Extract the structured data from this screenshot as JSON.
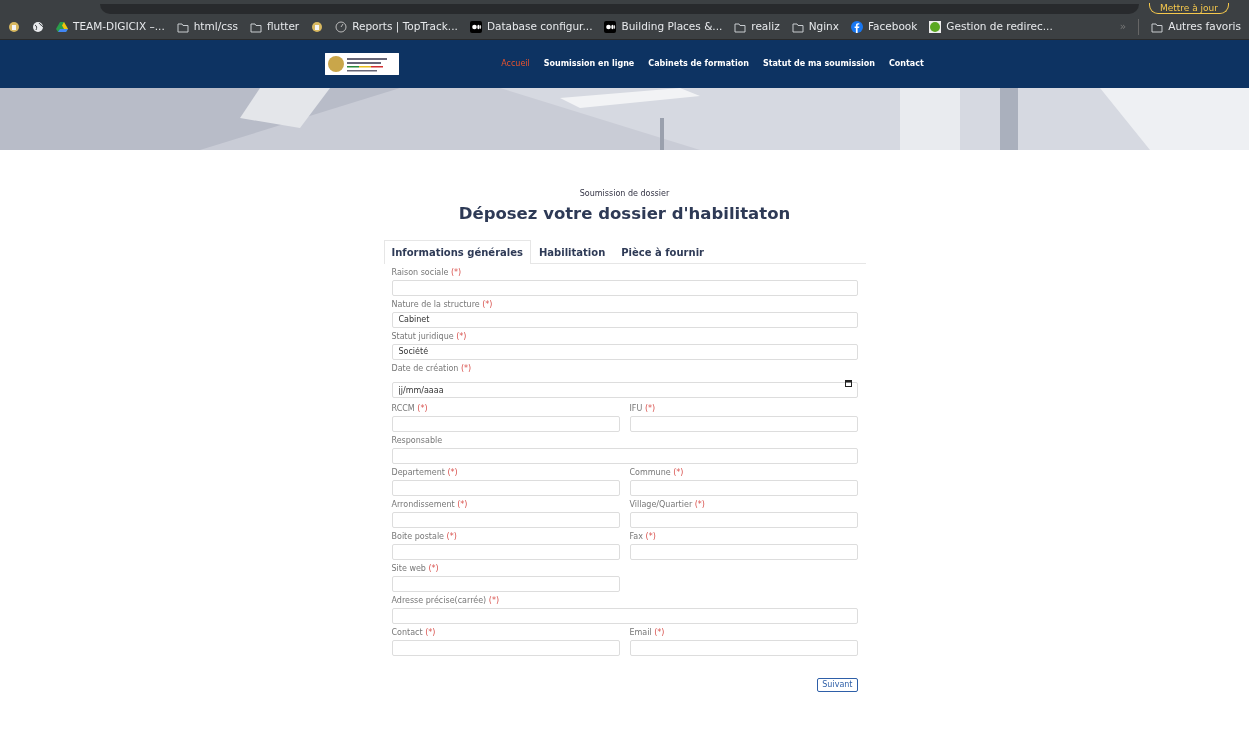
{
  "browser": {
    "update_button": "Mettre à jour",
    "bookmarks": [
      {
        "kind": "emblem"
      },
      {
        "kind": "globe"
      },
      {
        "kind": "drive",
        "label": "TEAM-DIGICIX –..."
      },
      {
        "kind": "folder",
        "label": "html/css"
      },
      {
        "kind": "folder",
        "label": "flutter"
      },
      {
        "kind": "emblem"
      },
      {
        "kind": "clock",
        "label": "Reports | TopTrack..."
      },
      {
        "kind": "medium",
        "label": "Database configur..."
      },
      {
        "kind": "medium",
        "label": "Building Places &..."
      },
      {
        "kind": "folder",
        "label": "realiz"
      },
      {
        "kind": "folder",
        "label": "Nginx"
      },
      {
        "kind": "facebook",
        "label": "Facebook"
      },
      {
        "kind": "square",
        "label": "Gestion de redirec..."
      }
    ],
    "overflow": "»",
    "other_bookmarks": "Autres favoris"
  },
  "navbar": {
    "links": [
      {
        "label": "Accueil",
        "selected": true
      },
      {
        "label": "Soumission en ligne",
        "selected": false
      },
      {
        "label": "Cabinets de formation",
        "selected": false
      },
      {
        "label": "Statut de ma soumission",
        "selected": false
      },
      {
        "label": "Contact",
        "selected": false
      }
    ]
  },
  "subtitle": "Soumission de dossier",
  "title": "Déposez votre dossier d'habilitaton",
  "tabs": [
    {
      "label": "Informations générales",
      "selected": true
    },
    {
      "label": "Habilitation",
      "selected": false
    },
    {
      "label": "Pièce à fournir",
      "selected": false
    }
  ],
  "rows": [
    {
      "fields": [
        {
          "kind": "text",
          "label": "Raison sociale",
          "required_mark": "(*)"
        }
      ]
    },
    {
      "fields": [
        {
          "kind": "text",
          "label": "Nature de la structure",
          "required_mark": "(*)",
          "value": "Cabinet"
        }
      ]
    },
    {
      "fields": [
        {
          "kind": "text",
          "label": "Statut juridique",
          "required_mark": "(*)",
          "value": "Société"
        }
      ]
    },
    {
      "fields": [
        {
          "kind": "date",
          "label": "Date de création",
          "required_mark": "(*)",
          "placeholder": "jj/mm/aaaa"
        }
      ]
    },
    {
      "fields": [
        {
          "kind": "text",
          "label": "RCCM",
          "required_mark": "(*)"
        },
        {
          "kind": "text",
          "label": "IFU",
          "required_mark": "(*)"
        }
      ]
    },
    {
      "fields": [
        {
          "kind": "text",
          "label": "Responsable"
        }
      ]
    },
    {
      "fields": [
        {
          "kind": "text",
          "label": "Departement",
          "required_mark": "(*)"
        },
        {
          "kind": "text",
          "label": "Commune",
          "required_mark": "(*)"
        }
      ]
    },
    {
      "fields": [
        {
          "kind": "text",
          "label": "Arrondissement",
          "required_mark": "(*)"
        },
        {
          "kind": "text",
          "label": "Village/Quartier",
          "required_mark": "(*)"
        }
      ]
    },
    {
      "fields": [
        {
          "kind": "text",
          "label": "Boite postale",
          "required_mark": "(*)"
        },
        {
          "kind": "text",
          "label": "Fax",
          "required_mark": "(*)"
        }
      ]
    },
    {
      "fields": [
        {
          "kind": "text",
          "label": "Site web",
          "required_mark": "(*)",
          "wide": false
        }
      ]
    },
    {
      "fields": [
        {
          "kind": "text",
          "label": "Adresse précise(carrée)",
          "required_mark": "(*)"
        }
      ]
    },
    {
      "fields": [
        {
          "kind": "text",
          "label": "Contact",
          "required_mark": "(*)"
        },
        {
          "kind": "text",
          "label": "Email",
          "required_mark": "(*)"
        }
      ]
    }
  ],
  "next_button": "Suivant"
}
